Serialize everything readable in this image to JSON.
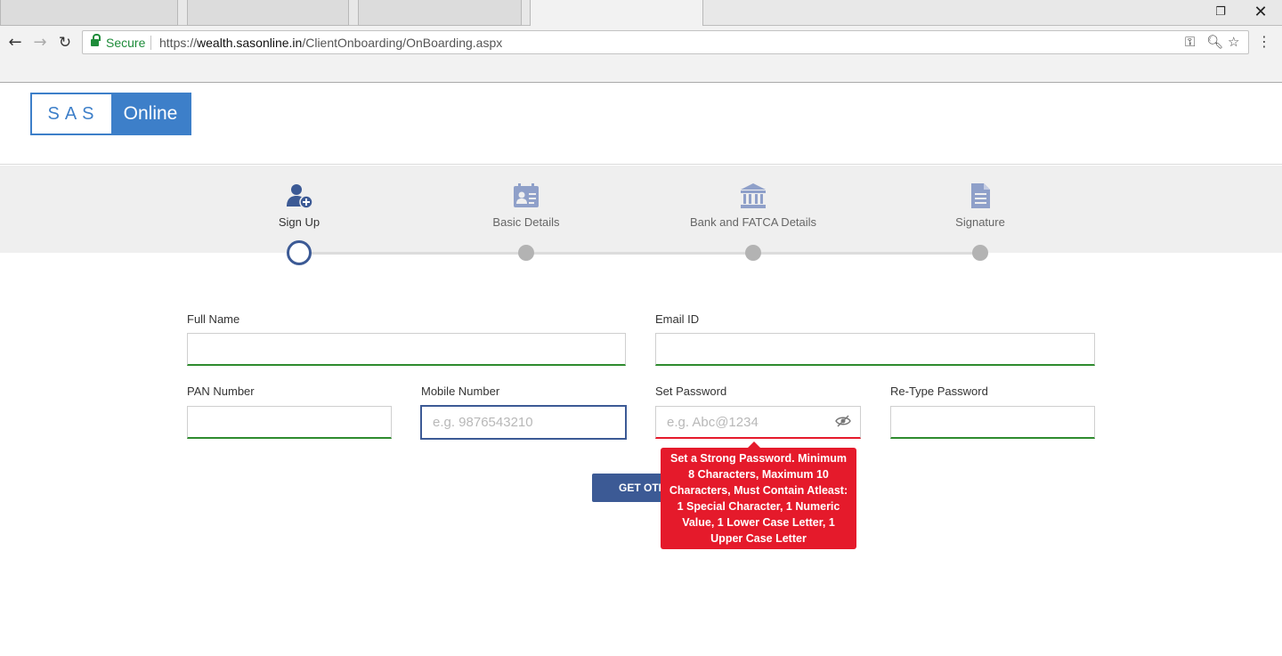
{
  "browser": {
    "secure_label": "Secure",
    "url_prefix": "https://",
    "url_host": "wealth.sasonline.in",
    "url_path": "/ClientOnboarding/OnBoarding.aspx"
  },
  "logo": {
    "left_text": "SAS",
    "right_text": "Online",
    "brand_color": "#3d7fc9"
  },
  "steps": [
    {
      "label": "Sign Up",
      "icon": "user-add-icon",
      "active": true
    },
    {
      "label": "Basic Details",
      "icon": "id-card-icon",
      "active": false
    },
    {
      "label": "Bank and FATCA Details",
      "icon": "bank-icon",
      "active": false
    },
    {
      "label": "Signature",
      "icon": "document-icon",
      "active": false
    }
  ],
  "form": {
    "full_name": {
      "label": "Full Name",
      "value": ""
    },
    "email": {
      "label": "Email ID",
      "value": ""
    },
    "pan": {
      "label": "PAN Number",
      "value": ""
    },
    "mobile": {
      "label": "Mobile Number",
      "placeholder": "e.g. 9876543210",
      "value": ""
    },
    "password": {
      "label": "Set Password",
      "placeholder": "e.g. Abc@1234",
      "value": ""
    },
    "retype_password": {
      "label": "Re-Type Password",
      "value": ""
    },
    "otp_button": "GET OTP"
  },
  "password_tooltip": "Set a Strong Password. Minimum 8 Characters, Maximum 10 Characters, Must Contain Atleast: 1 Special Character, 1 Numeric Value, 1 Lower Case Letter, 1 Upper Case Letter",
  "colors": {
    "primary": "#3c5a95",
    "error": "#e51a2b",
    "valid": "#2e8b2e"
  }
}
